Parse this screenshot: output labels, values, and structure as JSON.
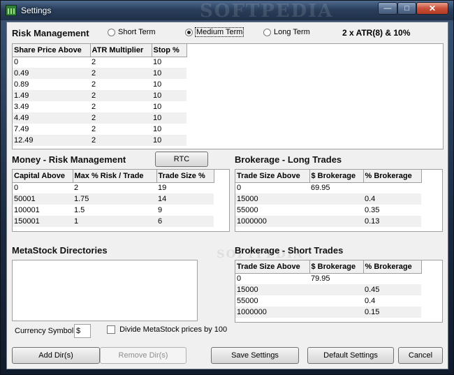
{
  "window": {
    "title": "Settings",
    "watermark": "SOFTPEDIA",
    "controls": {
      "minimize": "—",
      "maximize": "□",
      "close": "✕"
    }
  },
  "risk": {
    "heading": "Risk Management",
    "options": [
      {
        "label": "Short Term",
        "selected": false
      },
      {
        "label": "Medium Term",
        "selected": true
      },
      {
        "label": "Long Term",
        "selected": false
      }
    ],
    "summary": "2 x ATR(8) & 10%",
    "table": {
      "columns": [
        "Share Price Above",
        "ATR Multiplier",
        "Stop %"
      ],
      "rows": [
        [
          "0",
          "2",
          "10"
        ],
        [
          "0.49",
          "2",
          "10"
        ],
        [
          "0.89",
          "2",
          "10"
        ],
        [
          "1.49",
          "2",
          "10"
        ],
        [
          "3.49",
          "2",
          "10"
        ],
        [
          "4.49",
          "2",
          "10"
        ],
        [
          "7.49",
          "2",
          "10"
        ],
        [
          "12.49",
          "2",
          "10"
        ]
      ]
    }
  },
  "money": {
    "heading": "Money - Risk Management",
    "rtc_label": "RTC",
    "table": {
      "columns": [
        "Capital Above",
        "Max % Risk / Trade",
        "Trade Size %"
      ],
      "rows": [
        [
          "0",
          "2",
          "19"
        ],
        [
          "50001",
          "1.75",
          "14"
        ],
        [
          "100001",
          "1.5",
          "9"
        ],
        [
          "150001",
          "1",
          "6"
        ]
      ]
    }
  },
  "brokerage_long": {
    "heading": "Brokerage - Long Trades",
    "table": {
      "columns": [
        "Trade Size Above",
        "$ Brokerage",
        "% Brokerage"
      ],
      "rows": [
        [
          "0",
          "69.95",
          ""
        ],
        [
          "15000",
          "",
          "0.4"
        ],
        [
          "55000",
          "",
          "0.35"
        ],
        [
          "1000000",
          "",
          "0.13"
        ]
      ]
    }
  },
  "brokerage_short": {
    "heading": "Brokerage - Short Trades",
    "table": {
      "columns": [
        "Trade Size Above",
        "$ Brokerage",
        "% Brokerage"
      ],
      "rows": [
        [
          "0",
          "79.95",
          ""
        ],
        [
          "15000",
          "",
          "0.45"
        ],
        [
          "55000",
          "",
          "0.4"
        ],
        [
          "1000000",
          "",
          "0.15"
        ]
      ]
    }
  },
  "metastock": {
    "heading": "MetaStock Directories",
    "currency_label": "Currency Symbol",
    "currency_value": "$",
    "divide_label": "Divide MetaStock prices by 100",
    "divide_checked": false,
    "watermark": "SOFTPEDIA"
  },
  "buttons": {
    "add_dir": "Add Dir(s)",
    "remove_dir": "Remove Dir(s)",
    "save": "Save Settings",
    "default": "Default Settings",
    "cancel": "Cancel"
  }
}
